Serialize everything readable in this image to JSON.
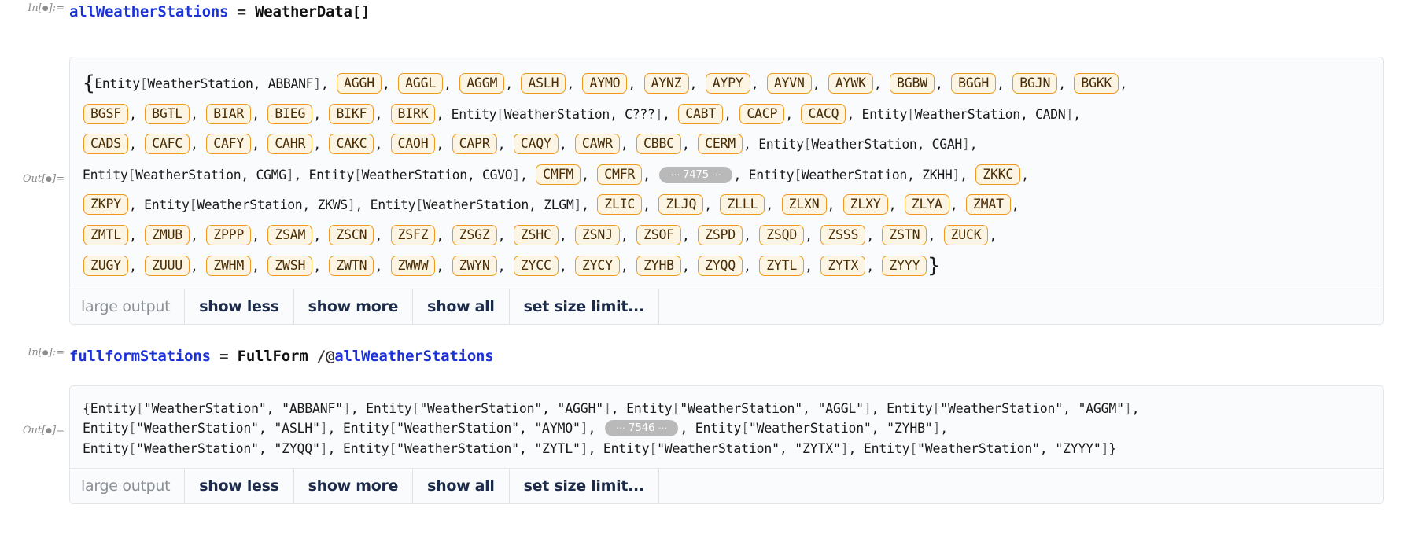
{
  "notebook": {
    "cells": [
      {
        "id": "cell-1",
        "in_label": "In[",
        "in_label_end": "]:=",
        "code": {
          "variable": "allWeatherStations",
          "assign": "=",
          "func": "WeatherData",
          "brackets": "[]"
        }
      },
      {
        "id": "cell-2",
        "out_label": "Out[",
        "out_label_end": "]="
      }
    ]
  },
  "input1": {
    "label_start": "In[",
    "label_end": "]:=",
    "variable": "allWeatherStations",
    "operator": "=",
    "function": "WeatherData",
    "open_bracket": "[",
    "close_bracket": "]"
  },
  "input2": {
    "label_start": "In[",
    "label_end": "]:=",
    "variable": "fullformStations",
    "operator": "=",
    "function": "FullForm",
    "map_operator": "/@",
    "argument": "allWeatherStations"
  },
  "output1": {
    "label_start": "Out[",
    "label_end": "]=",
    "open_brace": "{",
    "close_brace": "}",
    "entity_head": "Entity",
    "entity_type": "WeatherStation",
    "skip_marker": {
      "left_dots": "⋯",
      "count": "7475",
      "right_dots": "⋯"
    },
    "lines": [
      {
        "tokens": [
          {
            "type": "brace",
            "text": "{"
          },
          {
            "type": "full",
            "name": "ABBANF"
          },
          {
            "type": "pill",
            "text": "AGGH"
          },
          {
            "type": "pill",
            "text": "AGGL"
          },
          {
            "type": "pill",
            "text": "AGGM"
          },
          {
            "type": "pill",
            "text": "ASLH"
          },
          {
            "type": "pill",
            "text": "AYMO"
          },
          {
            "type": "pill",
            "text": "AYNZ"
          },
          {
            "type": "pill",
            "text": "AYPY"
          },
          {
            "type": "pill",
            "text": "AYVN"
          },
          {
            "type": "pill",
            "text": "AYWK"
          },
          {
            "type": "pill",
            "text": "BGBW"
          },
          {
            "type": "pill",
            "text": "BGGH"
          },
          {
            "type": "pill",
            "text": "BGJN"
          },
          {
            "type": "pill",
            "text": "BGKK"
          }
        ]
      },
      {
        "tokens": [
          {
            "type": "pill",
            "text": "BGSF"
          },
          {
            "type": "pill",
            "text": "BGTL"
          },
          {
            "type": "pill",
            "text": "BIAR"
          },
          {
            "type": "pill",
            "text": "BIEG"
          },
          {
            "type": "pill",
            "text": "BIKF"
          },
          {
            "type": "pill",
            "text": "BIRK"
          },
          {
            "type": "full",
            "name": "C???"
          },
          {
            "type": "pill",
            "text": "CABT"
          },
          {
            "type": "pill",
            "text": "CACP"
          },
          {
            "type": "pill",
            "text": "CACQ"
          },
          {
            "type": "full",
            "name": "CADN"
          }
        ]
      },
      {
        "tokens": [
          {
            "type": "pill",
            "text": "CADS"
          },
          {
            "type": "pill",
            "text": "CAFC"
          },
          {
            "type": "pill",
            "text": "CAFY"
          },
          {
            "type": "pill",
            "text": "CAHR"
          },
          {
            "type": "pill",
            "text": "CAKC"
          },
          {
            "type": "pill",
            "text": "CAOH"
          },
          {
            "type": "pill",
            "text": "CAPR"
          },
          {
            "type": "pill",
            "text": "CAQY"
          },
          {
            "type": "pill",
            "text": "CAWR"
          },
          {
            "type": "pill",
            "text": "CBBC"
          },
          {
            "type": "pill",
            "text": "CERM"
          },
          {
            "type": "full",
            "name": "CGAH"
          }
        ]
      },
      {
        "tokens": [
          {
            "type": "full",
            "name": "CGMG"
          },
          {
            "type": "full",
            "name": "CGVO"
          },
          {
            "type": "pill",
            "text": "CMFM"
          },
          {
            "type": "pill",
            "text": "CMFR"
          },
          {
            "type": "skip",
            "count": "7475"
          },
          {
            "type": "full",
            "name": "ZKHH"
          },
          {
            "type": "pill",
            "text": "ZKKC"
          }
        ]
      },
      {
        "tokens": [
          {
            "type": "pill",
            "text": "ZKPY"
          },
          {
            "type": "full",
            "name": "ZKWS"
          },
          {
            "type": "full",
            "name": "ZLGM"
          },
          {
            "type": "pill",
            "text": "ZLIC"
          },
          {
            "type": "pill",
            "text": "ZLJQ"
          },
          {
            "type": "pill",
            "text": "ZLLL"
          },
          {
            "type": "pill",
            "text": "ZLXN"
          },
          {
            "type": "pill",
            "text": "ZLXY"
          },
          {
            "type": "pill",
            "text": "ZLYA"
          },
          {
            "type": "pill",
            "text": "ZMAT"
          }
        ]
      },
      {
        "tokens": [
          {
            "type": "pill",
            "text": "ZMTL"
          },
          {
            "type": "pill",
            "text": "ZMUB"
          },
          {
            "type": "pill",
            "text": "ZPPP"
          },
          {
            "type": "pill",
            "text": "ZSAM"
          },
          {
            "type": "pill",
            "text": "ZSCN"
          },
          {
            "type": "pill",
            "text": "ZSFZ"
          },
          {
            "type": "pill",
            "text": "ZSGZ"
          },
          {
            "type": "pill",
            "text": "ZSHC"
          },
          {
            "type": "pill",
            "text": "ZSNJ"
          },
          {
            "type": "pill",
            "text": "ZSOF"
          },
          {
            "type": "pill",
            "text": "ZSPD"
          },
          {
            "type": "pill",
            "text": "ZSQD"
          },
          {
            "type": "pill",
            "text": "ZSSS"
          },
          {
            "type": "pill",
            "text": "ZSTN"
          },
          {
            "type": "pill",
            "text": "ZUCK"
          }
        ]
      },
      {
        "tokens": [
          {
            "type": "pill",
            "text": "ZUGY"
          },
          {
            "type": "pill",
            "text": "ZUUU"
          },
          {
            "type": "pill",
            "text": "ZWHM"
          },
          {
            "type": "pill",
            "text": "ZWSH"
          },
          {
            "type": "pill",
            "text": "ZWTN"
          },
          {
            "type": "pill",
            "text": "ZWWW"
          },
          {
            "type": "pill",
            "text": "ZWYN"
          },
          {
            "type": "pill",
            "text": "ZYCC"
          },
          {
            "type": "pill",
            "text": "ZYCY"
          },
          {
            "type": "pill",
            "text": "ZYHB"
          },
          {
            "type": "pill",
            "text": "ZYQQ"
          },
          {
            "type": "pill",
            "text": "ZYTL"
          },
          {
            "type": "pill",
            "text": "ZYTX"
          },
          {
            "type": "pill",
            "text": "ZYYY",
            "last": true
          },
          {
            "type": "brace",
            "text": "}"
          }
        ]
      }
    ]
  },
  "output2": {
    "label_start": "Out[",
    "label_end": "]=",
    "skip_marker": {
      "left_dots": "⋯",
      "count": "7546",
      "right_dots": "⋯"
    },
    "lines": [
      "{Entity[\"WeatherStation\", \"ABBANF\"], Entity[\"WeatherStation\", \"AGGH\"], Entity[\"WeatherStation\", \"AGGL\"], Entity[\"WeatherStation\", \"AGGM\"],",
      "Entity[\"WeatherStation\", \"ASLH\"], Entity[\"WeatherStation\", \"AYMO\"], @SKIP@ Entity[\"WeatherStation\", \"ZYHB\"],",
      "Entity[\"WeatherStation\", \"ZYQQ\"], Entity[\"WeatherStation\", \"ZYTL\"], Entity[\"WeatherStation\", \"ZYTX\"], Entity[\"WeatherStation\", \"ZYYY\"]}"
    ]
  },
  "control_bar": {
    "status": "large output",
    "buttons": [
      "show less",
      "show more",
      "show all",
      "set size limit..."
    ]
  }
}
